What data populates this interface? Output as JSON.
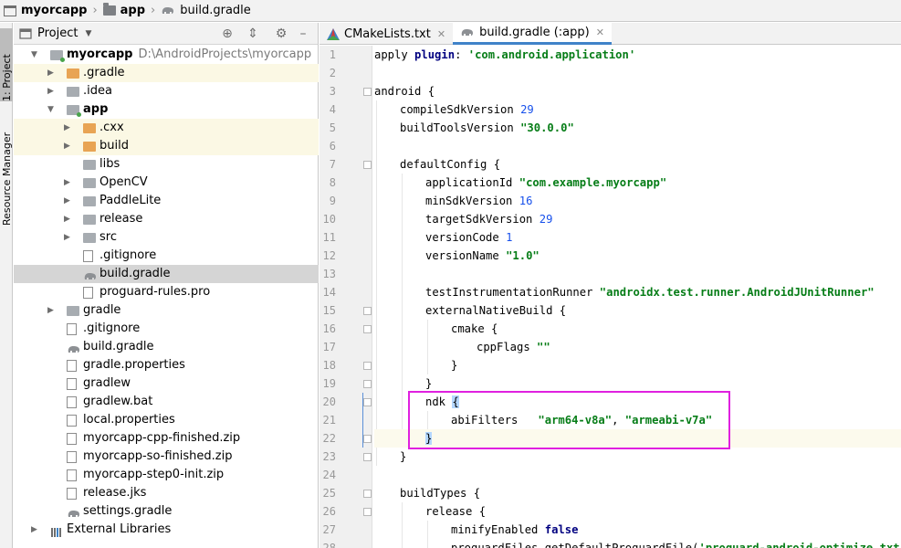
{
  "breadcrumb": {
    "project": "myorcapp",
    "module": "app",
    "file": "build.gradle"
  },
  "stripe": {
    "project_tab": "1: Project",
    "resource_tab": "Resource Manager"
  },
  "project_panel": {
    "title": "Project",
    "tree": [
      {
        "label": "myorcapp",
        "path": "D:\\AndroidProjects\\myorcapp",
        "level": 0,
        "arrow": "down",
        "icon": "module",
        "bold": true,
        "bg": "none"
      },
      {
        "label": ".gradle",
        "level": 1,
        "arrow": "right",
        "icon": "folder-orange",
        "bg": "yellow"
      },
      {
        "label": ".idea",
        "level": 1,
        "arrow": "right",
        "icon": "folder-gray",
        "bg": "none"
      },
      {
        "label": "app",
        "level": 1,
        "arrow": "down",
        "icon": "module",
        "bold": true,
        "bg": "none"
      },
      {
        "label": ".cxx",
        "level": 2,
        "arrow": "right",
        "icon": "folder-orange",
        "bg": "yellow"
      },
      {
        "label": "build",
        "level": 2,
        "arrow": "right",
        "icon": "folder-orange",
        "bg": "yellow"
      },
      {
        "label": "libs",
        "level": 2,
        "arrow": "none",
        "icon": "folder-gray",
        "bg": "none"
      },
      {
        "label": "OpenCV",
        "level": 2,
        "arrow": "right",
        "icon": "folder-gray",
        "bg": "none"
      },
      {
        "label": "PaddleLite",
        "level": 2,
        "arrow": "right",
        "icon": "folder-gray",
        "bg": "none"
      },
      {
        "label": "release",
        "level": 2,
        "arrow": "right",
        "icon": "folder-gray",
        "bg": "none"
      },
      {
        "label": "src",
        "level": 2,
        "arrow": "right",
        "icon": "folder-gray",
        "bg": "none"
      },
      {
        "label": ".gitignore",
        "level": 2,
        "arrow": "none",
        "icon": "file",
        "bg": "none"
      },
      {
        "label": "build.gradle",
        "level": 2,
        "arrow": "none",
        "icon": "gradle",
        "bg": "selected"
      },
      {
        "label": "proguard-rules.pro",
        "level": 2,
        "arrow": "none",
        "icon": "file",
        "bg": "none"
      },
      {
        "label": "gradle",
        "level": 1,
        "arrow": "right",
        "icon": "folder-gray",
        "bg": "none"
      },
      {
        "label": ".gitignore",
        "level": 1,
        "arrow": "none",
        "icon": "file",
        "bg": "none"
      },
      {
        "label": "build.gradle",
        "level": 1,
        "arrow": "none",
        "icon": "gradle",
        "bg": "none"
      },
      {
        "label": "gradle.properties",
        "level": 1,
        "arrow": "none",
        "icon": "file",
        "bg": "none"
      },
      {
        "label": "gradlew",
        "level": 1,
        "arrow": "none",
        "icon": "file",
        "bg": "none"
      },
      {
        "label": "gradlew.bat",
        "level": 1,
        "arrow": "none",
        "icon": "file",
        "bg": "none"
      },
      {
        "label": "local.properties",
        "level": 1,
        "arrow": "none",
        "icon": "file",
        "bg": "none"
      },
      {
        "label": "myorcapp-cpp-finished.zip",
        "level": 1,
        "arrow": "none",
        "icon": "file",
        "bg": "none"
      },
      {
        "label": "myorcapp-so-finished.zip",
        "level": 1,
        "arrow": "none",
        "icon": "file",
        "bg": "none"
      },
      {
        "label": "myorcapp-step0-init.zip",
        "level": 1,
        "arrow": "none",
        "icon": "file",
        "bg": "none"
      },
      {
        "label": "release.jks",
        "level": 1,
        "arrow": "none",
        "icon": "file",
        "bg": "none"
      },
      {
        "label": "settings.gradle",
        "level": 1,
        "arrow": "none",
        "icon": "gradle",
        "bg": "none"
      },
      {
        "label": "External Libraries",
        "level": 0,
        "arrow": "right",
        "icon": "library",
        "bg": "none"
      }
    ]
  },
  "tabs": [
    {
      "label": "CMakeLists.txt",
      "active": false
    },
    {
      "label": "build.gradle (:app)",
      "active": true
    }
  ],
  "editor": {
    "lines": [
      {
        "n": "1",
        "indent": 0,
        "html": "apply <span class='kw'>plugin</span>: <span class='str'>'com.android.application'</span>"
      },
      {
        "n": "2",
        "indent": 0,
        "html": ""
      },
      {
        "n": "3",
        "indent": 0,
        "html": "android {",
        "fold": true
      },
      {
        "n": "4",
        "indent": 1,
        "html": "compileSdkVersion <span class='num'>29</span>"
      },
      {
        "n": "5",
        "indent": 1,
        "html": "buildToolsVersion <span class='str'>\"30.0.0\"</span>"
      },
      {
        "n": "6",
        "indent": 0,
        "html": ""
      },
      {
        "n": "7",
        "indent": 1,
        "html": "defaultConfig {",
        "fold": true
      },
      {
        "n": "8",
        "indent": 2,
        "html": "applicationId <span class='str'>\"com.example.myorcapp\"</span>"
      },
      {
        "n": "9",
        "indent": 2,
        "html": "minSdkVersion <span class='num'>16</span>"
      },
      {
        "n": "10",
        "indent": 2,
        "html": "targetSdkVersion <span class='num'>29</span>"
      },
      {
        "n": "11",
        "indent": 2,
        "html": "versionCode <span class='num'>1</span>"
      },
      {
        "n": "12",
        "indent": 2,
        "html": "versionName <span class='str'>\"1.0\"</span>"
      },
      {
        "n": "13",
        "indent": 0,
        "html": ""
      },
      {
        "n": "14",
        "indent": 2,
        "html": "testInstrumentationRunner <span class='str'>\"androidx.test.runner.AndroidJUnitRunner\"</span>"
      },
      {
        "n": "15",
        "indent": 2,
        "html": "externalNativeBuild {",
        "fold": true
      },
      {
        "n": "16",
        "indent": 3,
        "html": "cmake {",
        "fold": true
      },
      {
        "n": "17",
        "indent": 4,
        "html": "cppFlags <span class='str'>\"\"</span>"
      },
      {
        "n": "18",
        "indent": 3,
        "html": "}",
        "fold": true
      },
      {
        "n": "19",
        "indent": 2,
        "html": "}",
        "fold": true
      },
      {
        "n": "20",
        "indent": 2,
        "html": "ndk <span class='brace-hl'>{</span>",
        "fold": true
      },
      {
        "n": "21",
        "indent": 3,
        "html": "abiFilters   <span class='str'>\"arm64-v8a\"</span>, <span class='str'>\"armeabi-v7a\"</span>"
      },
      {
        "n": "22",
        "indent": 2,
        "html": "<span class='brace-hl'>}</span>",
        "fold": true,
        "current": true
      },
      {
        "n": "23",
        "indent": 1,
        "html": "}",
        "fold": true
      },
      {
        "n": "24",
        "indent": 0,
        "html": ""
      },
      {
        "n": "25",
        "indent": 1,
        "html": "buildTypes {",
        "fold": true
      },
      {
        "n": "26",
        "indent": 2,
        "html": "release {",
        "fold": true
      },
      {
        "n": "27",
        "indent": 3,
        "html": "minifyEnabled <span class='kw'>false</span>"
      },
      {
        "n": "28",
        "indent": 3,
        "html": "proguardFiles getDefaultProguardFile(<span class='str'>'proguard-android-optimize.txt'</span>)"
      }
    ]
  }
}
